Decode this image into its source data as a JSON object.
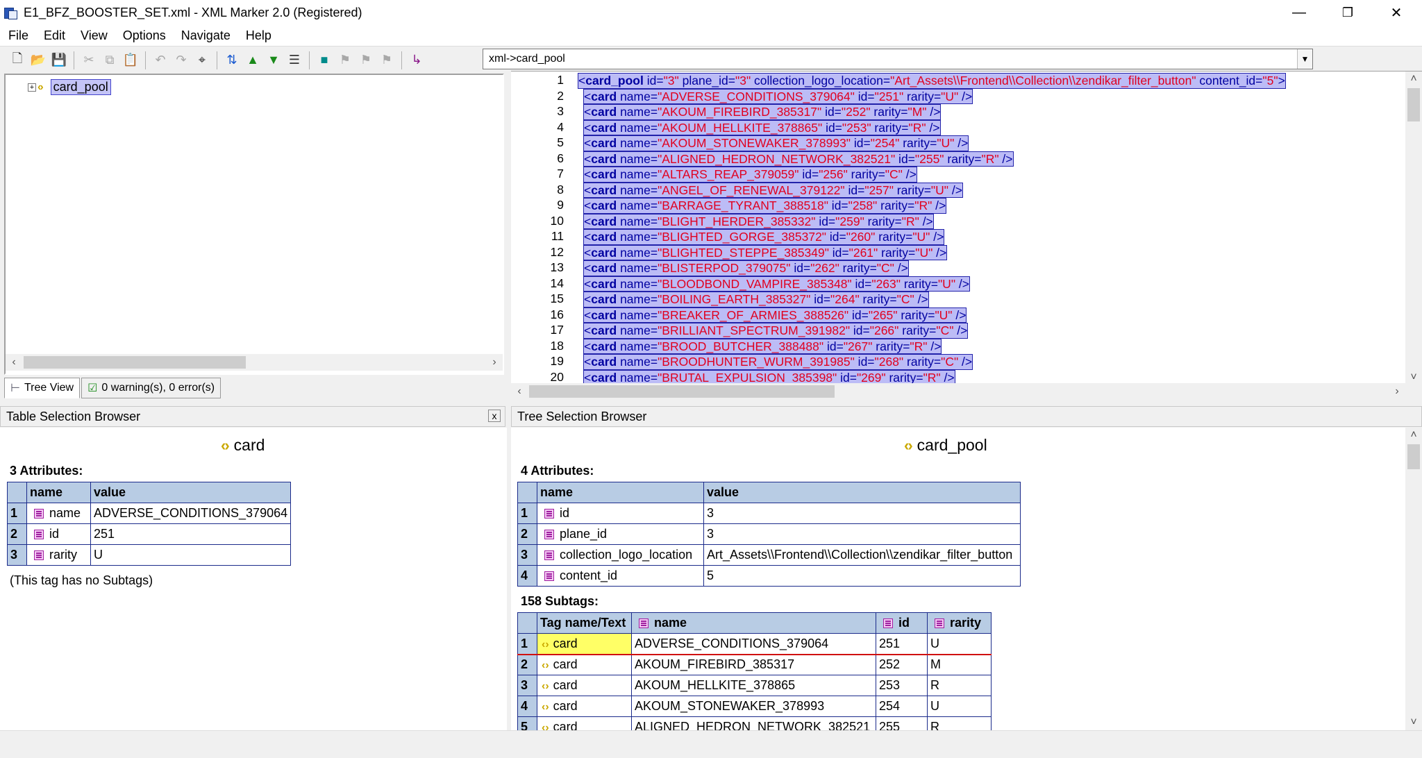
{
  "window": {
    "title": "E1_BFZ_BOOSTER_SET.xml - XML Marker 2.0 (Registered)",
    "minimize": "—",
    "restore": "❐",
    "close": "✕"
  },
  "menu": [
    "File",
    "Edit",
    "View",
    "Options",
    "Navigate",
    "Help"
  ],
  "path_combo": {
    "value": "xml->card_pool"
  },
  "tree": {
    "root_label": "card_pool",
    "expander": "+"
  },
  "tabs": {
    "tree_view": "Tree View",
    "errors": "0 warning(s), 0 error(s)"
  },
  "editor": {
    "root_line": {
      "num": "1",
      "tag": "card_pool",
      "attrs": [
        {
          "k": "id",
          "v": "\"3\""
        },
        {
          "k": "plane_id",
          "v": "\"3\""
        },
        {
          "k": "collection_logo_location",
          "v": "\"Art_Assets\\\\Frontend\\\\Collection\\\\zendikar_filter_button\""
        },
        {
          "k": "content_id",
          "v": "\"5\""
        }
      ]
    },
    "cards": [
      {
        "num": "2",
        "name": "\"ADVERSE_CONDITIONS_379064\"",
        "id": "\"251\"",
        "rarity": "\"U\""
      },
      {
        "num": "3",
        "name": "\"AKOUM_FIREBIRD_385317\"",
        "id": "\"252\"",
        "rarity": "\"M\""
      },
      {
        "num": "4",
        "name": "\"AKOUM_HELLKITE_378865\"",
        "id": "\"253\"",
        "rarity": "\"R\""
      },
      {
        "num": "5",
        "name": "\"AKOUM_STONEWAKER_378993\"",
        "id": "\"254\"",
        "rarity": "\"U\""
      },
      {
        "num": "6",
        "name": "\"ALIGNED_HEDRON_NETWORK_382521\"",
        "id": "\"255\"",
        "rarity": "\"R\""
      },
      {
        "num": "7",
        "name": "\"ALTARS_REAP_379059\"",
        "id": "\"256\"",
        "rarity": "\"C\""
      },
      {
        "num": "8",
        "name": "\"ANGEL_OF_RENEWAL_379122\"",
        "id": "\"257\"",
        "rarity": "\"U\""
      },
      {
        "num": "9",
        "name": "\"BARRAGE_TYRANT_388518\"",
        "id": "\"258\"",
        "rarity": "\"R\""
      },
      {
        "num": "10",
        "name": "\"BLIGHT_HERDER_385332\"",
        "id": "\"259\"",
        "rarity": "\"R\""
      },
      {
        "num": "11",
        "name": "\"BLIGHTED_GORGE_385372\"",
        "id": "\"260\"",
        "rarity": "\"U\""
      },
      {
        "num": "12",
        "name": "\"BLIGHTED_STEPPE_385349\"",
        "id": "\"261\"",
        "rarity": "\"U\""
      },
      {
        "num": "13",
        "name": "\"BLISTERPOD_379075\"",
        "id": "\"262\"",
        "rarity": "\"C\""
      },
      {
        "num": "14",
        "name": "\"BLOODBOND_VAMPIRE_385348\"",
        "id": "\"263\"",
        "rarity": "\"U\""
      },
      {
        "num": "15",
        "name": "\"BOILING_EARTH_385327\"",
        "id": "\"264\"",
        "rarity": "\"C\""
      },
      {
        "num": "16",
        "name": "\"BREAKER_OF_ARMIES_388526\"",
        "id": "\"265\"",
        "rarity": "\"U\""
      },
      {
        "num": "17",
        "name": "\"BRILLIANT_SPECTRUM_391982\"",
        "id": "\"266\"",
        "rarity": "\"C\""
      },
      {
        "num": "18",
        "name": "\"BROOD_BUTCHER_388488\"",
        "id": "\"267\"",
        "rarity": "\"R\""
      },
      {
        "num": "19",
        "name": "\"BROODHUNTER_WURM_391985\"",
        "id": "\"268\"",
        "rarity": "\"C\""
      },
      {
        "num": "20",
        "name": "\"BRUTAL_EXPULSION_385398\"",
        "id": "\"269\"",
        "rarity": "\"R\""
      }
    ]
  },
  "table_browser": {
    "header": "Table Selection Browser",
    "node_name": "card",
    "attr_count": "3 Attributes:",
    "col_name": "name",
    "col_value": "value",
    "rows": [
      {
        "idx": "1",
        "name": "name",
        "value": "ADVERSE_CONDITIONS_379064"
      },
      {
        "idx": "2",
        "name": "id",
        "value": "251"
      },
      {
        "idx": "3",
        "name": "rarity",
        "value": "U"
      }
    ],
    "no_subtags": "(This tag has no Subtags)"
  },
  "tree_browser": {
    "header": "Tree Selection Browser",
    "node_name": "card_pool",
    "attr_count": "4 Attributes:",
    "col_name": "name",
    "col_value": "value",
    "rows": [
      {
        "idx": "1",
        "name": "id",
        "value": "3"
      },
      {
        "idx": "2",
        "name": "plane_id",
        "value": "3"
      },
      {
        "idx": "3",
        "name": "collection_logo_location",
        "value": "Art_Assets\\\\Frontend\\\\Collection\\\\zendikar_filter_button"
      },
      {
        "idx": "4",
        "name": "content_id",
        "value": "5"
      }
    ],
    "subtag_count": "158 Subtags:",
    "sub_cols": {
      "tag": "Tag name/Text",
      "name": "name",
      "id": "id",
      "rarity": "rarity"
    },
    "subtags": [
      {
        "idx": "1",
        "tag": "card",
        "name": "ADVERSE_CONDITIONS_379064",
        "id": "251",
        "rarity": "U"
      },
      {
        "idx": "2",
        "tag": "card",
        "name": "AKOUM_FIREBIRD_385317",
        "id": "252",
        "rarity": "M"
      },
      {
        "idx": "3",
        "tag": "card",
        "name": "AKOUM_HELLKITE_378865",
        "id": "253",
        "rarity": "R"
      },
      {
        "idx": "4",
        "tag": "card",
        "name": "AKOUM_STONEWAKER_378993",
        "id": "254",
        "rarity": "U"
      },
      {
        "idx": "5",
        "tag": "card",
        "name": "ALIGNED_HEDRON_NETWORK_382521",
        "id": "255",
        "rarity": "R"
      }
    ]
  },
  "colors": {
    "tag": "#0000a0",
    "value": "#e00020",
    "selection": "#bcbcf6",
    "grid_header": "#b8cce4"
  }
}
